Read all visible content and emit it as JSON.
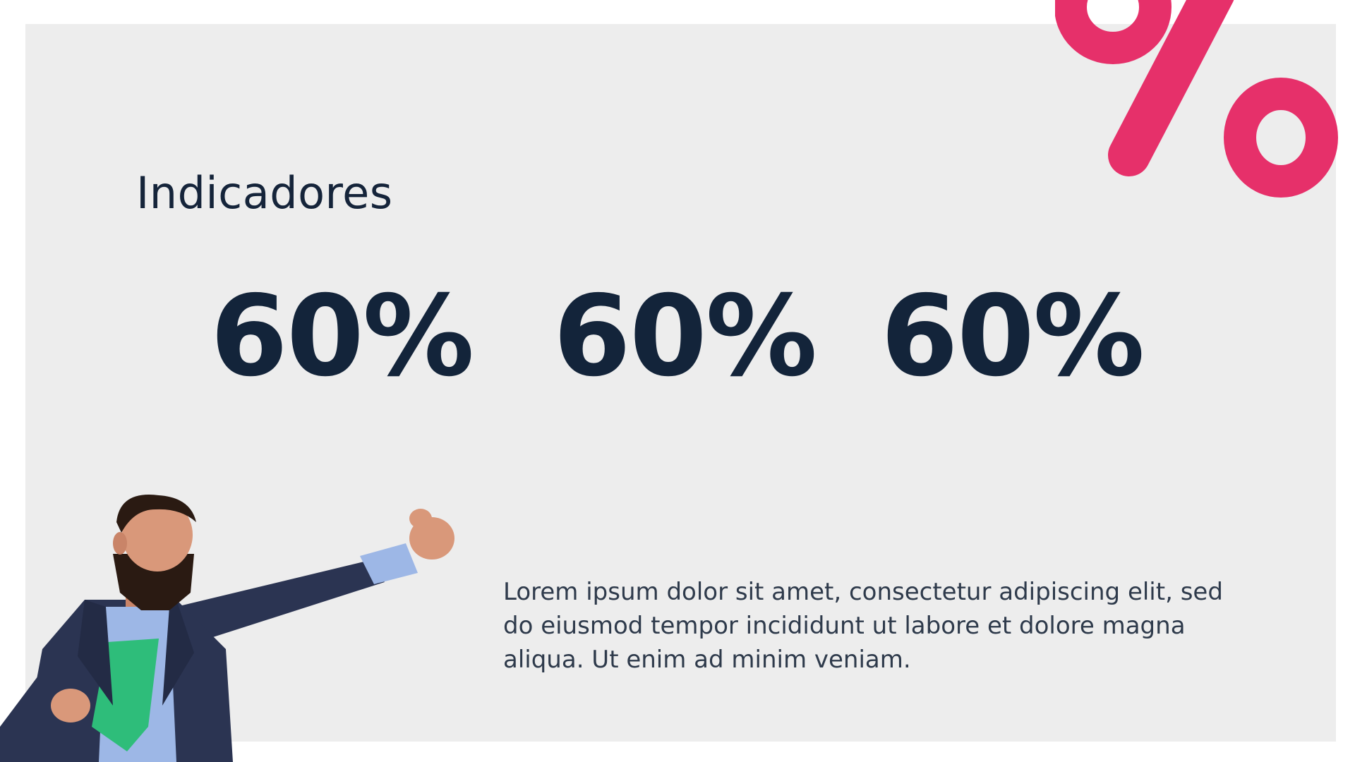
{
  "slide": {
    "title": "Indicadores",
    "stats": [
      {
        "value": "60%"
      },
      {
        "value": "60%"
      },
      {
        "value": "60%"
      }
    ],
    "body": "Lorem ipsum dolor sit amet, consectetur adipiscing elit, sed do eiusmod tempor incididunt ut labore et dolore magna aliqua. Ut enim ad minim veniam."
  },
  "decor": {
    "percent_icon": "percent-icon",
    "hero_image": "superhero-businessman-illustration"
  },
  "colors": {
    "panel_background": "#EDEDED",
    "accent": "#E6306A",
    "text_dark": "#13243A",
    "text_body": "#2E3A4B",
    "hero_suit": "#2B3452",
    "hero_shirt": "#9DB7E6",
    "hero_emblem": "#2EBD7A"
  }
}
